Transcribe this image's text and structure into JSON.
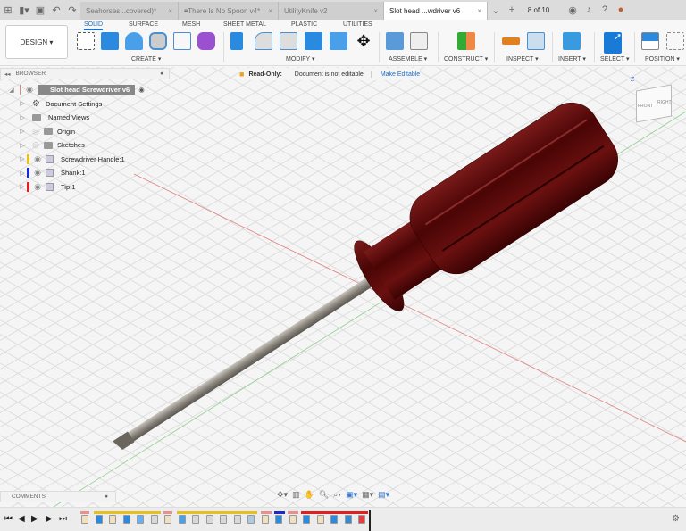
{
  "topbar": {
    "tabs": [
      {
        "label": "Seahorses...covered)*"
      },
      {
        "label": "There Is No Spoon v4*"
      },
      {
        "label": "UtilityKnife v2"
      },
      {
        "label": "Slot head ...wdriver v6"
      }
    ],
    "job_status": "8 of 10"
  },
  "toolbar": {
    "workspace": "DESIGN ▾",
    "tabs": [
      "SOLID",
      "SURFACE",
      "MESH",
      "SHEET METAL",
      "PLASTIC",
      "UTILITIES"
    ],
    "groups": [
      "CREATE ▾",
      "MODIFY ▾",
      "ASSEMBLE ▾",
      "CONSTRUCT ▾",
      "INSPECT ▾",
      "INSERT ▾",
      "SELECT ▾",
      "POSITION ▾"
    ]
  },
  "browser": {
    "title": "BROWSER",
    "root": "Slot head Screwdriver v6",
    "items": [
      {
        "label": "Document Settings"
      },
      {
        "label": "Named Views"
      },
      {
        "label": "Origin"
      },
      {
        "label": "Sketches"
      },
      {
        "label": "Screwdriver Handle:1",
        "color": "#e6c020"
      },
      {
        "label": "Shank:1",
        "color": "#1a2ad0"
      },
      {
        "label": "Tip:1",
        "color": "#e02020"
      }
    ]
  },
  "readonly": {
    "label": "Read-Only:",
    "message": "Document is not editable",
    "action": "Make Editable"
  },
  "viewcube": {
    "top": "Z",
    "front": "FRONT",
    "right": "RIGHT"
  },
  "comments": {
    "title": "COMMENTS"
  },
  "timeline": {
    "features": [
      "sketch",
      "extrude",
      "sketch",
      "extrude",
      "pattern",
      "fillet",
      "sketch",
      "revolve",
      "fillet",
      "fillet",
      "fillet",
      "fillet",
      "chamfer",
      "sketch",
      "extrude",
      "sketch",
      "extrude",
      "sketch",
      "extrude",
      "draft",
      "marker"
    ]
  },
  "colors": {
    "handle": "#5a0a0a",
    "shank": "#8c8880",
    "accent": "#1a6fc7"
  }
}
